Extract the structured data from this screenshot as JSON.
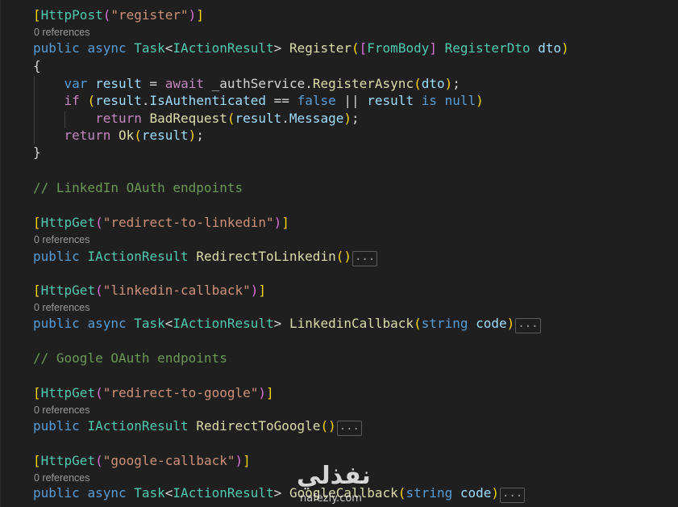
{
  "codelens": {
    "references": "0 references"
  },
  "fold": {
    "ellipsis": "..."
  },
  "watermark": {
    "arabic": "نفذلي",
    "latin": "nafezly.com"
  },
  "code": {
    "attr_httppost": "HttpPost",
    "attr_httpget": "HttpGet",
    "route_register": "\"register\"",
    "route_redirect_linkedin": "\"redirect-to-linkedin\"",
    "route_linkedin_callback": "\"linkedin-callback\"",
    "route_redirect_google": "\"redirect-to-google\"",
    "route_google_callback": "\"google-callback\"",
    "kw_public": "public",
    "kw_async": "async",
    "kw_var": "var",
    "kw_await": "await",
    "kw_if": "if",
    "kw_return": "return",
    "kw_false": "false",
    "kw_is": "is",
    "kw_null": "null",
    "kw_string": "string",
    "type_task": "Task",
    "type_iactionresult": "IActionResult",
    "type_frombody": "FromBody",
    "type_registerdto": "RegisterDto",
    "fn_register": "Register",
    "fn_registerasync": "RegisterAsync",
    "fn_badrequest": "BadRequest",
    "fn_ok": "Ok",
    "fn_redirect_linkedin": "RedirectToLinkedin",
    "fn_linkedin_callback": "LinkedinCallback",
    "fn_redirect_google": "RedirectToGoogle",
    "fn_google_callback": "GoogleCallback",
    "var_dto": "dto",
    "var_result": "result",
    "var_code": "code",
    "field_authservice": "_authService",
    "prop_isauthenticated": "IsAuthenticated",
    "prop_message": "Message",
    "comment_linkedin": "// LinkedIn OAuth endpoints",
    "comment_google": "// Google OAuth endpoints",
    "brace_open": "{",
    "brace_close": "}"
  }
}
